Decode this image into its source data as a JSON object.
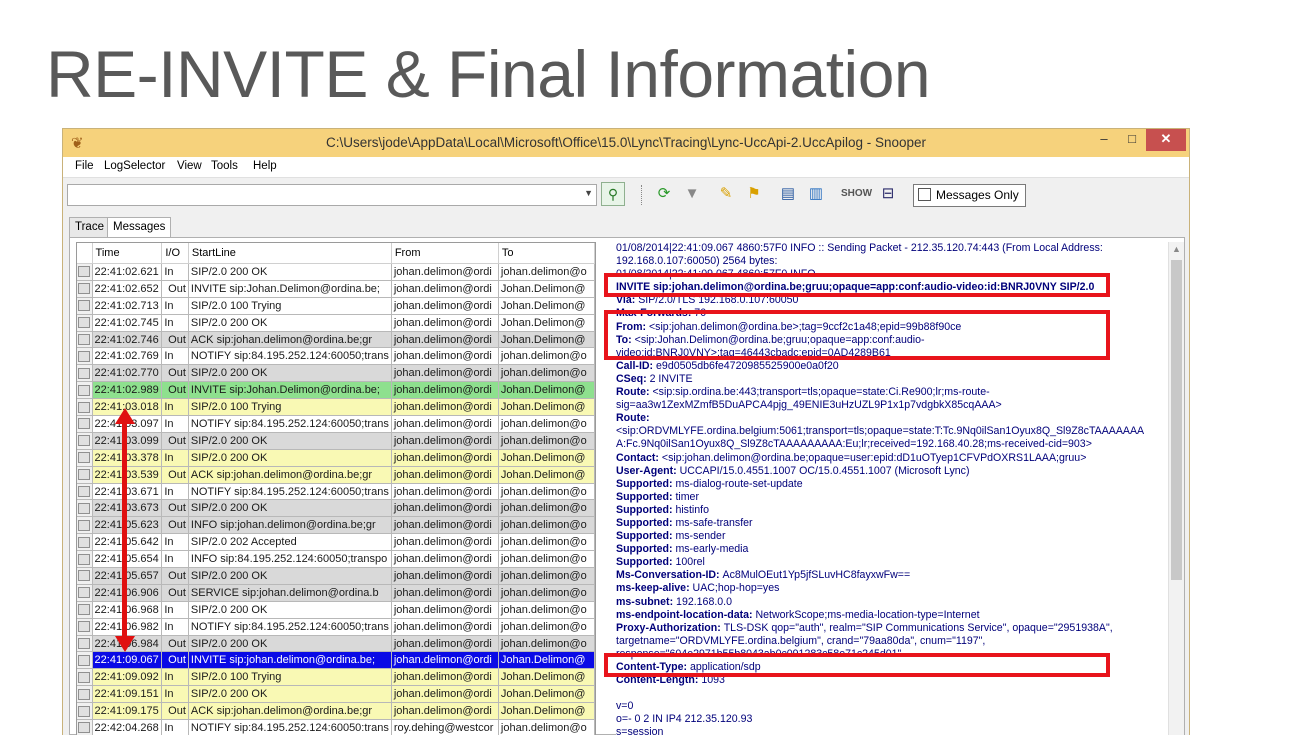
{
  "slide": {
    "title": "RE-INVITE & Final Information"
  },
  "window": {
    "title": "C:\\Users\\jode\\AppData\\Local\\Microsoft\\Office\\15.0\\Lync\\Tracing\\Lync-UccApi-2.UccApilog - Snooper",
    "minimize": "–",
    "maximize": "□",
    "close": "✕"
  },
  "menu": [
    "File",
    "LogSelector",
    "View",
    "Tools",
    "Help"
  ],
  "toolbar": {
    "search_value": "",
    "messages_only_label": "Messages Only"
  },
  "tabs": [
    "Trace",
    "Messages"
  ],
  "grid": {
    "columns": [
      "Time",
      "I/O",
      "StartLine",
      "From",
      "To"
    ],
    "rows": [
      {
        "time": "22:41:02.621",
        "io": "In",
        "start": "SIP/2.0 200 OK",
        "from": "johan.delimon@ordi",
        "to": "johan.delimon@o",
        "style": "hl-white"
      },
      {
        "time": "22:41:02.652",
        "io": "Out",
        "start": "INVITE sip:Johan.Delimon@ordina.be;",
        "from": "johan.delimon@ordi",
        "to": "Johan.Delimon@",
        "style": "hl-white"
      },
      {
        "time": "22:41:02.713",
        "io": "In",
        "start": "SIP/2.0 100 Trying",
        "from": "johan.delimon@ordi",
        "to": "Johan.Delimon@",
        "style": "hl-white"
      },
      {
        "time": "22:41:02.745",
        "io": "In",
        "start": "SIP/2.0 200 OK",
        "from": "johan.delimon@ordi",
        "to": "Johan.Delimon@",
        "style": "hl-white"
      },
      {
        "time": "22:41:02.746",
        "io": "Out",
        "start": "ACK sip:johan.delimon@ordina.be;gr",
        "from": "johan.delimon@ordi",
        "to": "Johan.Delimon@",
        "style": "hl-grey"
      },
      {
        "time": "22:41:02.769",
        "io": "In",
        "start": "NOTIFY sip:84.195.252.124:60050;trans",
        "from": "johan.delimon@ordi",
        "to": "johan.delimon@o",
        "style": "hl-white"
      },
      {
        "time": "22:41:02.770",
        "io": "Out",
        "start": "SIP/2.0 200 OK",
        "from": "johan.delimon@ordi",
        "to": "johan.delimon@o",
        "style": "hl-grey"
      },
      {
        "time": "22:41:02.989",
        "io": "Out",
        "start": "INVITE sip:Johan.Delimon@ordina.be;",
        "from": "johan.delimon@ordi",
        "to": "Johan.Delimon@",
        "style": "hl-green"
      },
      {
        "time": "22:41:03.018",
        "io": "In",
        "start": "SIP/2.0 100 Trying",
        "from": "johan.delimon@ordi",
        "to": "Johan.Delimon@",
        "style": "hl-yellow"
      },
      {
        "time": "22:41:03.097",
        "io": "In",
        "start": "NOTIFY sip:84.195.252.124:60050;trans",
        "from": "johan.delimon@ordi",
        "to": "johan.delimon@o",
        "style": "hl-white"
      },
      {
        "time": "22:41:03.099",
        "io": "Out",
        "start": "SIP/2.0 200 OK",
        "from": "johan.delimon@ordi",
        "to": "johan.delimon@o",
        "style": "hl-grey"
      },
      {
        "time": "22:41:03.378",
        "io": "In",
        "start": "SIP/2.0 200 OK",
        "from": "johan.delimon@ordi",
        "to": "Johan.Delimon@",
        "style": "hl-yellow"
      },
      {
        "time": "22:41:03.539",
        "io": "Out",
        "start": "ACK sip:johan.delimon@ordina.be;gr",
        "from": "johan.delimon@ordi",
        "to": "Johan.Delimon@",
        "style": "hl-yellow"
      },
      {
        "time": "22:41:03.671",
        "io": "In",
        "start": "NOTIFY sip:84.195.252.124:60050;trans",
        "from": "johan.delimon@ordi",
        "to": "johan.delimon@o",
        "style": "hl-white"
      },
      {
        "time": "22:41:03.673",
        "io": "Out",
        "start": "SIP/2.0 200 OK",
        "from": "johan.delimon@ordi",
        "to": "johan.delimon@o",
        "style": "hl-grey"
      },
      {
        "time": "22:41:05.623",
        "io": "Out",
        "start": "INFO sip:johan.delimon@ordina.be;gr",
        "from": "johan.delimon@ordi",
        "to": "johan.delimon@o",
        "style": "hl-grey"
      },
      {
        "time": "22:41:05.642",
        "io": "In",
        "start": "SIP/2.0 202 Accepted",
        "from": "johan.delimon@ordi",
        "to": "johan.delimon@o",
        "style": "hl-white"
      },
      {
        "time": "22:41:05.654",
        "io": "In",
        "start": "INFO sip:84.195.252.124:60050;transpo",
        "from": "johan.delimon@ordi",
        "to": "johan.delimon@o",
        "style": "hl-white"
      },
      {
        "time": "22:41:05.657",
        "io": "Out",
        "start": "SIP/2.0 200 OK",
        "from": "johan.delimon@ordi",
        "to": "johan.delimon@o",
        "style": "hl-grey"
      },
      {
        "time": "22:41:06.906",
        "io": "Out",
        "start": "SERVICE sip:johan.delimon@ordina.b",
        "from": "johan.delimon@ordi",
        "to": "johan.delimon@o",
        "style": "hl-grey"
      },
      {
        "time": "22:41:06.968",
        "io": "In",
        "start": "SIP/2.0 200 OK",
        "from": "johan.delimon@ordi",
        "to": "johan.delimon@o",
        "style": "hl-white"
      },
      {
        "time": "22:41:06.982",
        "io": "In",
        "start": "NOTIFY sip:84.195.252.124:60050;trans",
        "from": "johan.delimon@ordi",
        "to": "johan.delimon@o",
        "style": "hl-white"
      },
      {
        "time": "22:41:06.984",
        "io": "Out",
        "start": "SIP/2.0 200 OK",
        "from": "johan.delimon@ordi",
        "to": "johan.delimon@o",
        "style": "hl-grey"
      },
      {
        "time": "22:41:09.067",
        "io": "Out",
        "start": "INVITE sip:johan.delimon@ordina.be;",
        "from": "johan.delimon@ordi",
        "to": "Johan.Delimon@",
        "style": "hl-blue"
      },
      {
        "time": "22:41:09.092",
        "io": "In",
        "start": "SIP/2.0 100 Trying",
        "from": "johan.delimon@ordi",
        "to": "Johan.Delimon@",
        "style": "hl-yellow"
      },
      {
        "time": "22:41:09.151",
        "io": "In",
        "start": "SIP/2.0 200 OK",
        "from": "johan.delimon@ordi",
        "to": "Johan.Delimon@",
        "style": "hl-yellow"
      },
      {
        "time": "22:41:09.175",
        "io": "Out",
        "start": "ACK sip:johan.delimon@ordina.be;gr",
        "from": "johan.delimon@ordi",
        "to": "Johan.Delimon@",
        "style": "hl-yellow"
      },
      {
        "time": "22:42:04.268",
        "io": "In",
        "start": "NOTIFY sip:84.195.252.124:60050:trans",
        "from": "roy.dehing@westcor",
        "to": "johan.delimon@o",
        "style": "hl-white"
      }
    ]
  },
  "detail": {
    "lines": [
      {
        "k": "",
        "v": "01/08/2014|22:41:09.067 4860:57F0 INFO  :: Sending Packet - 212.35.120.74:443 (From Local Address:"
      },
      {
        "k": "",
        "v": "192.168.0.107:60050) 2564 bytes:"
      },
      {
        "k": "",
        "v": "01/08/2014|22:41:09.067 4860:57F0 INFO"
      },
      {
        "k": "INVITE sip:johan.delimon@ordina.be;gruu;opaque=app:conf:audio-video:id:BNRJ0VNY SIP/2.0",
        "v": ""
      },
      {
        "k": "Via: ",
        "v": "SIP/2.0/TLS 192.168.0.107:60050"
      },
      {
        "k": "Max-Forwards: ",
        "v": "70"
      },
      {
        "k": "From: ",
        "v": "<sip:johan.delimon@ordina.be>;tag=9ccf2c1a48;epid=99b88f90ce"
      },
      {
        "k": "To: ",
        "v": "<sip:Johan.Delimon@ordina.be;gruu;opaque=app:conf:audio-"
      },
      {
        "k": "",
        "v": "video:id:BNRJ0VNY>;tag=46443cbadc;epid=0AD4289B61"
      },
      {
        "k": "Call-ID: ",
        "v": "e9d0505db6fe4720985525900e0a0f20"
      },
      {
        "k": "CSeq: ",
        "v": "2 INVITE"
      },
      {
        "k": "Route: ",
        "v": "<sip:sip.ordina.be:443;transport=tls;opaque=state:Ci.Re900;lr;ms-route-"
      },
      {
        "k": "",
        "v": "sig=aa3w1ZexMZmfB5DuAPCA4pjg_49ENIE3uHzUZL9P1x1p7vdgbkX85cqAAA>"
      },
      {
        "k": "Route:",
        "v": ""
      },
      {
        "k": "",
        "v": "<sip:ORDVMLYFE.ordina.belgium:5061;transport=tls;opaque=state:T:Tc.9Nq0ilSan1Oyux8Q_Sl9Z8cTAAAAAAA"
      },
      {
        "k": "",
        "v": "A:Fc.9Nq0ilSan1Oyux8Q_Sl9Z8cTAAAAAAAAA:Eu;lr;received=192.168.40.28;ms-received-cid=903>"
      },
      {
        "k": "Contact: ",
        "v": "<sip:johan.delimon@ordina.be;opaque=user:epid:dD1uOTyep1CFVPdOXRS1LAAA;gruu>"
      },
      {
        "k": "User-Agent: ",
        "v": "UCCAPI/15.0.4551.1007 OC/15.0.4551.1007 (Microsoft Lync)"
      },
      {
        "k": "Supported: ",
        "v": "ms-dialog-route-set-update"
      },
      {
        "k": "Supported: ",
        "v": "timer"
      },
      {
        "k": "Supported: ",
        "v": "histinfo"
      },
      {
        "k": "Supported: ",
        "v": "ms-safe-transfer"
      },
      {
        "k": "Supported: ",
        "v": "ms-sender"
      },
      {
        "k": "Supported: ",
        "v": "ms-early-media"
      },
      {
        "k": "Supported: ",
        "v": "100rel"
      },
      {
        "k": "Ms-Conversation-ID: ",
        "v": "Ac8MulOEut1Yp5jfSLuvHC8fayxwFw=="
      },
      {
        "k": "ms-keep-alive: ",
        "v": "UAC;hop-hop=yes"
      },
      {
        "k": "ms-subnet: ",
        "v": "192.168.0.0"
      },
      {
        "k": "ms-endpoint-location-data: ",
        "v": "NetworkScope;ms-media-location-type=Internet"
      },
      {
        "k": "Proxy-Authorization: ",
        "v": "TLS-DSK qop=\"auth\", realm=\"SIP Communications Service\", opaque=\"2951938A\","
      },
      {
        "k": "",
        "v": "targetname=\"ORDVMLYFE.ordina.belgium\", crand=\"79aa80da\", cnum=\"1197\","
      },
      {
        "k": "",
        "v": "response=\"604e2971b55b8043ab0c091283c58e71c245d01\""
      },
      {
        "k": "Content-Type: ",
        "v": "application/sdp"
      },
      {
        "k": "Content-Length: ",
        "v": "1093"
      },
      {
        "k": "",
        "v": ""
      },
      {
        "k": "",
        "v": "v=0"
      },
      {
        "k": "",
        "v": "o=- 0 2 IN IP4 212.35.120.93"
      },
      {
        "k": "",
        "v": "s=session"
      }
    ]
  }
}
